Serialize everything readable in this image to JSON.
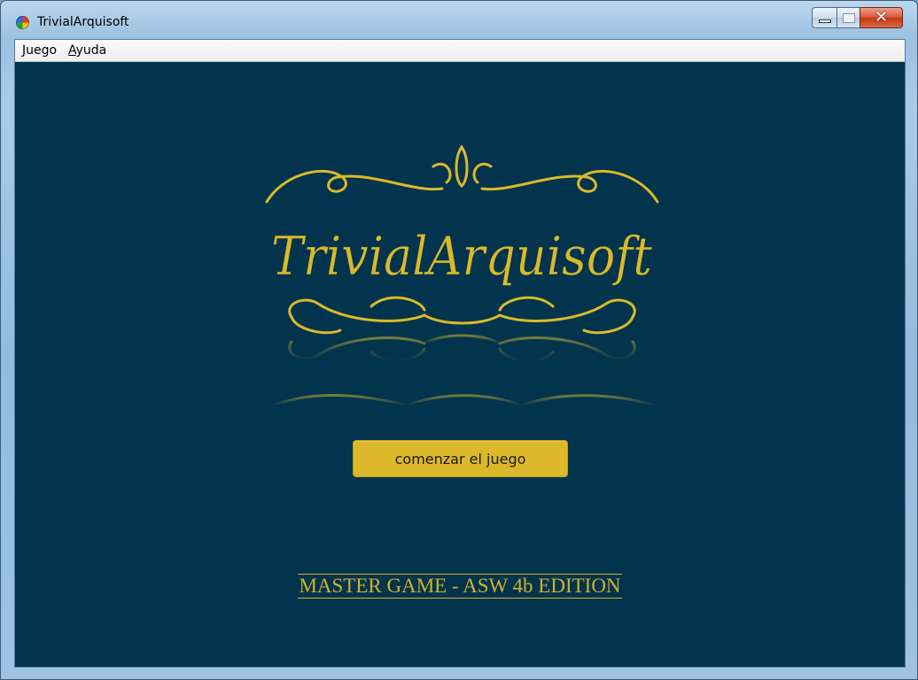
{
  "window": {
    "title": "TrivialArquisoft"
  },
  "menu": [
    {
      "mnemonic": "J",
      "rest": "uego"
    },
    {
      "mnemonic": "A",
      "rest": "yuda"
    }
  ],
  "logo": {
    "text": "TrivialArquisoft"
  },
  "start_button": {
    "label": "comenzar el juego"
  },
  "edition": {
    "text": "MASTER GAME - ASW 4b EDITION"
  },
  "colors": {
    "background": "#02344d",
    "accent": "#dbb92a",
    "gold_text": "#d3b12a"
  },
  "icons": {
    "app": "trivial-pie-icon",
    "minimize": "minimize-icon",
    "maximize": "maximize-icon",
    "close": "close-icon"
  }
}
